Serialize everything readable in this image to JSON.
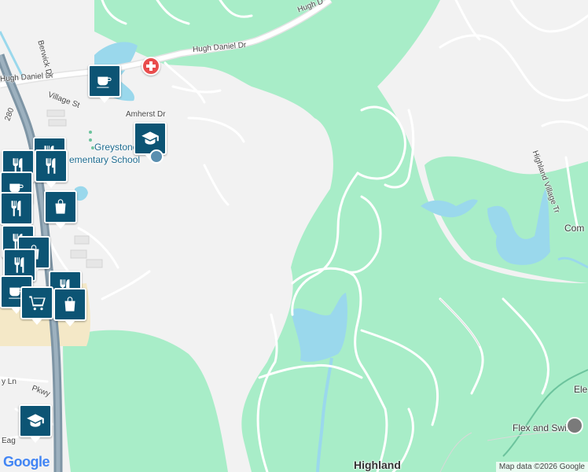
{
  "colors": {
    "land": "#f2f2f2",
    "park": "#a8edc8",
    "water": "#9ad8ec",
    "road": "#ffffff",
    "road_edge": "#d6d6d6",
    "highway": "#8fa6b6",
    "sand": "#f4e8c7",
    "pin": "#0c5474",
    "hospital": "#e94d4d"
  },
  "roads": {
    "hugh_daniel_top": "Hugh D",
    "hugh_daniel_mid": "Hugh Daniel Dr",
    "hugh_daniel_left": "Hugh Daniel Dr",
    "berwick": "Berwick Dr",
    "village": "Village St",
    "amherst": "Amherst Dr",
    "i280": "280",
    "highland_village": "Highland Village Tr",
    "partial_ln": "y Ln",
    "pkwy": "Pkwy",
    "eag": "Eag"
  },
  "places": {
    "school_1": "Greystone",
    "school_2": "ementary School",
    "comm": "Com",
    "ele": "Ele",
    "flex": "Flex and Swim",
    "highland": "Highland"
  },
  "markers": [
    {
      "id": "coffee-1",
      "icon": "coffee-icon"
    },
    {
      "id": "school-1",
      "icon": "school-icon"
    },
    {
      "id": "shopping-1",
      "icon": "shopping-bag-icon"
    },
    {
      "id": "restaurant-1",
      "icon": "restaurant-icon"
    },
    {
      "id": "cart-1",
      "icon": "shopping-cart-icon"
    },
    {
      "id": "school-2",
      "icon": "school-icon"
    }
  ],
  "footer": {
    "google": "Google",
    "attribution": "Map data ©2026 Google"
  }
}
